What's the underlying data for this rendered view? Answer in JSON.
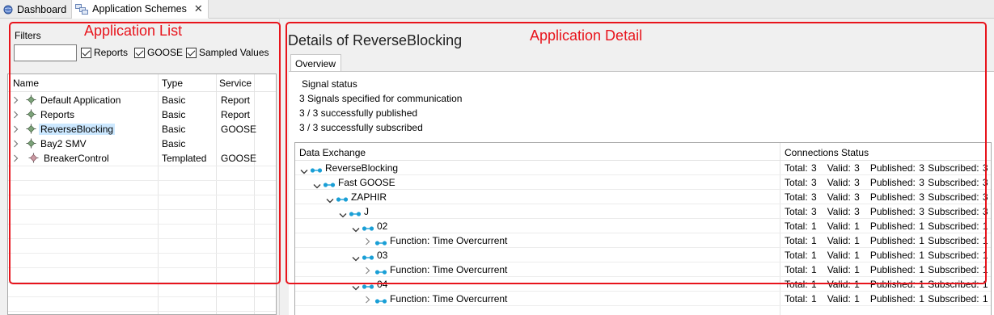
{
  "tabs": [
    {
      "label": "Dashboard",
      "icon": "globe-icon"
    },
    {
      "label": "Application Schemes",
      "icon": "schemes-icon",
      "active": true
    }
  ],
  "annotations": {
    "left_label": "Application List",
    "right_label": "Application Detail",
    "color": "#e8141c"
  },
  "filters": {
    "label": "Filters",
    "input_value": "",
    "checkboxes": [
      {
        "label": "Reports",
        "checked": true
      },
      {
        "label": "GOOSE",
        "checked": true
      },
      {
        "label": "Sampled Values",
        "checked": true
      }
    ]
  },
  "app_list": {
    "columns": [
      "Name",
      "Type",
      "Service"
    ],
    "rows": [
      {
        "name": "Default Application",
        "type": "Basic",
        "service": "Report"
      },
      {
        "name": "Reports",
        "type": "Basic",
        "service": "Report"
      },
      {
        "name": "ReverseBlocking",
        "type": "Basic",
        "service": "GOOSE",
        "selected": true
      },
      {
        "name": "Bay2 SMV",
        "type": "Basic",
        "service": ""
      },
      {
        "name": "BreakerControl",
        "type": "Templated",
        "service": "GOOSE"
      }
    ]
  },
  "detail": {
    "title": "Details of ReverseBlocking",
    "subtab": "Overview",
    "signal_status": {
      "label": "Signal status",
      "lines": [
        "3 Signals specified for communication",
        "3 / 3 successfully published",
        "3 / 3 successfully subscribed"
      ]
    },
    "data_exchange": {
      "columns": [
        "Data Exchange",
        "Connections Status"
      ],
      "rows": [
        {
          "label": "ReverseBlocking",
          "level": 0,
          "expanded": true,
          "status": "Total: 3   Valid: 3   Published: 3 Subscribed: 3"
        },
        {
          "label": "Fast GOOSE",
          "level": 1,
          "expanded": true,
          "status": "Total: 3   Valid: 3   Published: 3 Subscribed: 3"
        },
        {
          "label": "ZAPHIR",
          "level": 2,
          "expanded": true,
          "status": "Total: 3   Valid: 3   Published: 3 Subscribed: 3"
        },
        {
          "label": "J",
          "level": 3,
          "expanded": true,
          "status": "Total: 3   Valid: 3   Published: 3 Subscribed: 3"
        },
        {
          "label": "02",
          "level": 4,
          "expanded": true,
          "status": "Total: 1   Valid: 1   Published: 1 Subscribed: 1"
        },
        {
          "label": "Function: Time Overcurrent",
          "level": 5,
          "expanded": false,
          "status": "Total: 1   Valid: 1   Published: 1 Subscribed: 1"
        },
        {
          "label": "03",
          "level": 4,
          "expanded": true,
          "status": "Total: 1   Valid: 1   Published: 1 Subscribed: 1"
        },
        {
          "label": "Function: Time Overcurrent",
          "level": 5,
          "expanded": false,
          "status": "Total: 1   Valid: 1   Published: 1 Subscribed: 1"
        },
        {
          "label": "04",
          "level": 4,
          "expanded": true,
          "status": "Total: 1   Valid: 1   Published: 1 Subscribed: 1"
        },
        {
          "label": "Function: Time Overcurrent",
          "level": 5,
          "expanded": false,
          "status": "Total: 1   Valid: 1   Published: 1 Subscribed: 1"
        }
      ]
    }
  }
}
